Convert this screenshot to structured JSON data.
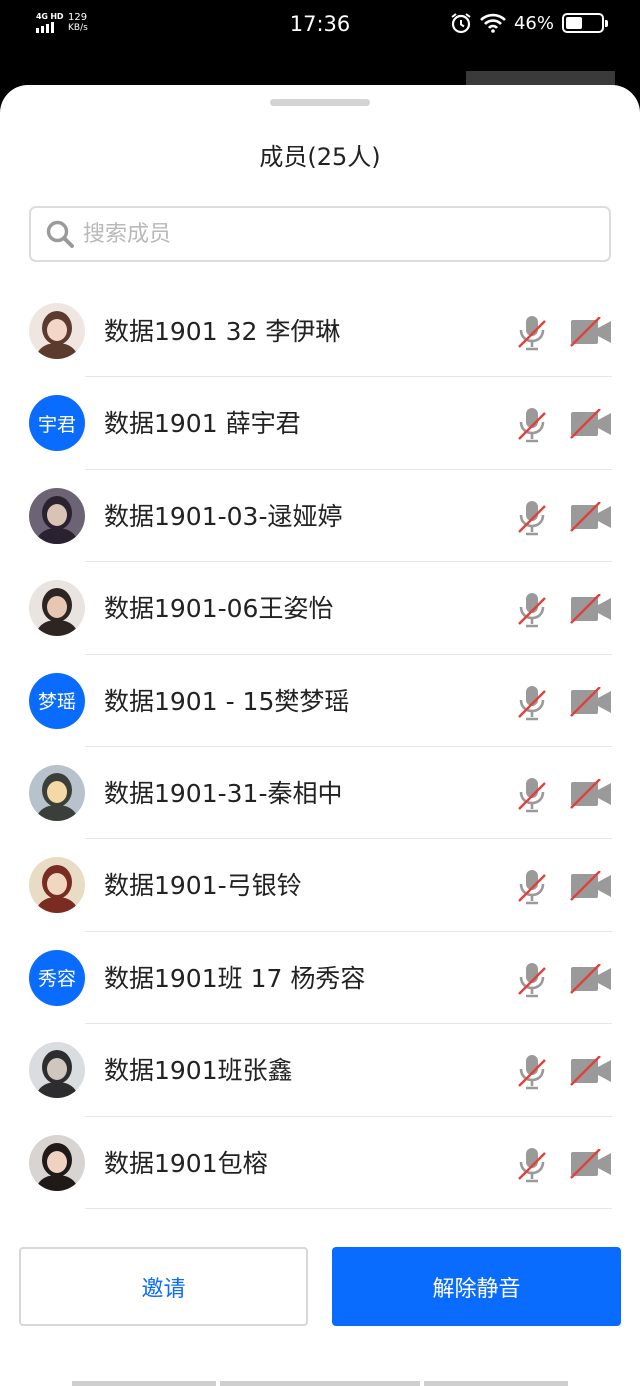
{
  "status_bar": {
    "network": "4G HD",
    "speed_value": "129",
    "speed_unit": "KB/s",
    "time": "17:36",
    "battery_percent": "46%",
    "battery_level": 0.46,
    "icons": [
      "alarm-icon",
      "wifi-icon",
      "battery-icon"
    ]
  },
  "panel": {
    "title": "成员(25人)"
  },
  "search": {
    "placeholder": "搜索成员",
    "value": ""
  },
  "members": [
    {
      "name": "数据1901 32 李伊琳",
      "avatar_type": "photo",
      "avatar_text": ""
    },
    {
      "name": "数据1901 薛宇君",
      "avatar_type": "text",
      "avatar_text": "宇君"
    },
    {
      "name": "数据1901-03-逯娅婷",
      "avatar_type": "photo",
      "avatar_text": ""
    },
    {
      "name": "数据1901-06王姿怡",
      "avatar_type": "photo",
      "avatar_text": ""
    },
    {
      "name": "数据1901 - 15樊梦瑶",
      "avatar_type": "text",
      "avatar_text": "梦瑶"
    },
    {
      "name": "数据1901-31-秦相中",
      "avatar_type": "photo",
      "avatar_text": ""
    },
    {
      "name": "数据1901-弓银铃",
      "avatar_type": "photo",
      "avatar_text": ""
    },
    {
      "name": "数据1901班 17 杨秀容",
      "avatar_type": "text",
      "avatar_text": "秀容"
    },
    {
      "name": "数据1901班张鑫",
      "avatar_type": "photo",
      "avatar_text": ""
    },
    {
      "name": "数据1901包榕",
      "avatar_type": "photo",
      "avatar_text": ""
    }
  ],
  "buttons": {
    "invite": "邀请",
    "unmute": "解除静音"
  },
  "colors": {
    "accent": "#0a6cff",
    "muted_slash": "#e0413a",
    "icon_gray": "#9a9a9a"
  }
}
